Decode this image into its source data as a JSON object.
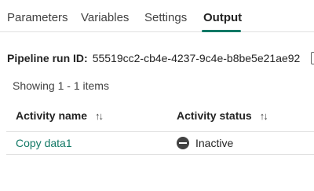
{
  "tabs": [
    {
      "label": "Parameters",
      "active": false
    },
    {
      "label": "Variables",
      "active": false
    },
    {
      "label": "Settings",
      "active": false
    },
    {
      "label": "Output",
      "active": true
    }
  ],
  "run": {
    "label": "Pipeline run ID:",
    "value": "55519cc2-cb4e-4237-9c4e-b8be5e21ae92"
  },
  "summary": "Showing 1 - 1 items",
  "table": {
    "columns": [
      {
        "label": "Activity name",
        "sort_icon": "sort-arrows-icon"
      },
      {
        "label": "Activity status",
        "sort_icon": "sort-arrows-icon"
      }
    ],
    "rows": [
      {
        "name": "Copy data1",
        "status": "Inactive",
        "status_icon": "inactive-icon"
      }
    ]
  },
  "colors": {
    "accent": "#117865",
    "status_icon": "#424242"
  }
}
